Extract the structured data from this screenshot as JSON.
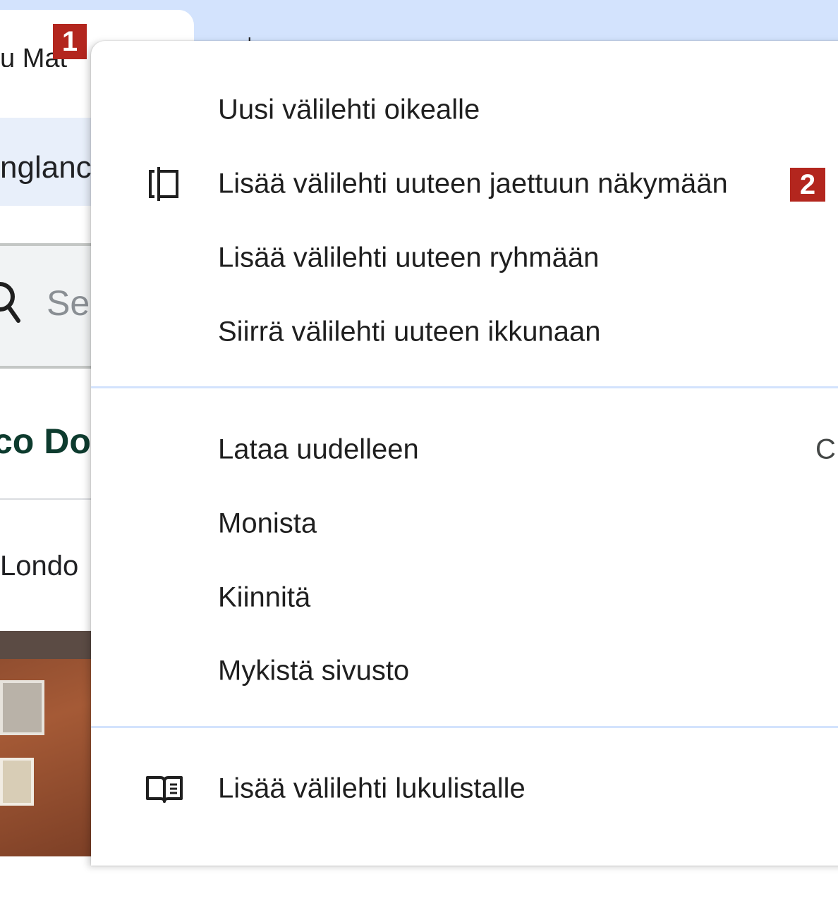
{
  "browser": {
    "tab_title": "u Mat",
    "tab_badge": "1",
    "new_tab_symbol": "+",
    "page": {
      "chip_text": "nglanc",
      "search_text": "Se",
      "heading_text": "co Do",
      "location_text": "Londo"
    }
  },
  "context_menu": {
    "groups": [
      {
        "items": [
          {
            "label": "Uusi välilehti oikealle",
            "icon": ""
          },
          {
            "label": "Lisää välilehti uuteen jaettuun näkymään",
            "icon": "split-view-icon",
            "badge": "2"
          },
          {
            "label": "Lisää välilehti uuteen ryhmään",
            "icon": ""
          },
          {
            "label": "Siirrä välilehti uuteen ikkunaan",
            "icon": ""
          }
        ]
      },
      {
        "items": [
          {
            "label": "Lataa uudelleen",
            "shortcut": "C"
          },
          {
            "label": "Monista"
          },
          {
            "label": "Kiinnitä"
          },
          {
            "label": "Mykistä sivusto"
          }
        ]
      },
      {
        "items": [
          {
            "label": "Lisää välilehti lukulistalle",
            "icon": "reading-list-icon"
          }
        ]
      }
    ]
  },
  "colors": {
    "tabstrip": "#d3e3fd",
    "badge": "#b3261e",
    "separator": "#d3e3fd",
    "menu_text": "#1f1f1f"
  }
}
